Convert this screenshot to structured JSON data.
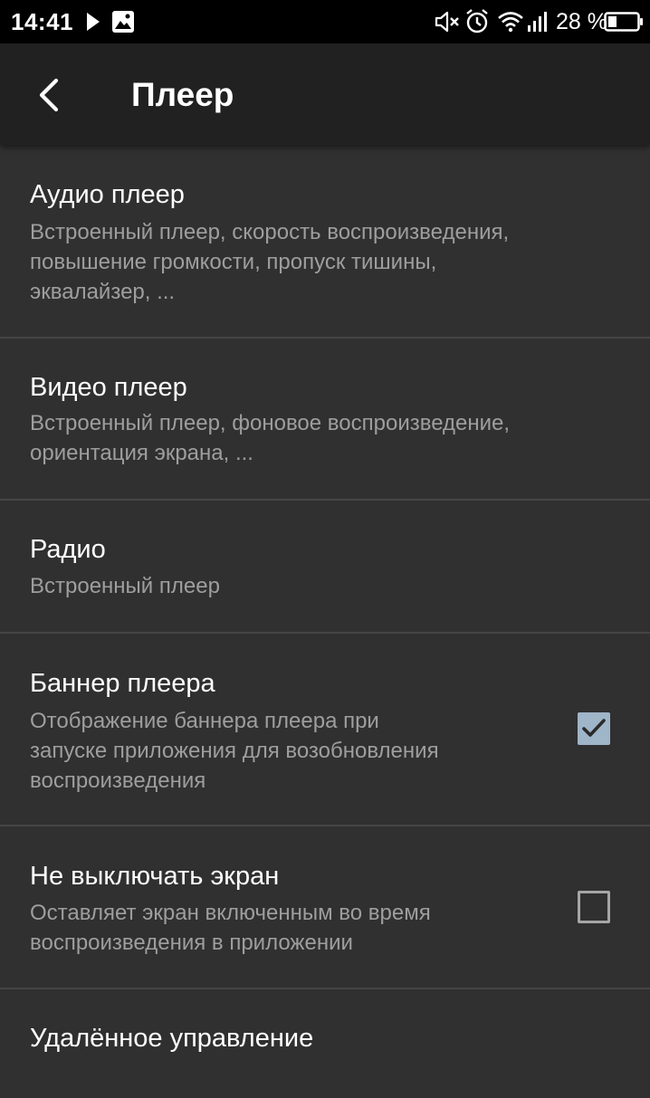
{
  "status_bar": {
    "time": "14:41",
    "battery_percent": "28 %",
    "icons": [
      "play-icon",
      "image-icon",
      "mute-icon",
      "alarm-icon",
      "wifi-icon",
      "signal-icon",
      "battery-icon"
    ]
  },
  "app_bar": {
    "back_icon": "back-arrow-icon",
    "title": "Плеер"
  },
  "settings": [
    {
      "title": "Аудио плеер",
      "summary": "Встроенный плеер, скорость воспроизведения,\nповышение громкости, пропуск тишины,\nэквалайзер, ..."
    },
    {
      "title": "Видео плеер",
      "summary": "Встроенный плеер, фоновое воспроизведение,\nориентация экрана, ..."
    },
    {
      "title": "Радио",
      "summary": "Встроенный плеер"
    },
    {
      "title": "Баннер плеера",
      "summary": "Отображение баннера плеера при\nзапуске приложения для возобновления\nвоспроизведения",
      "checked": true
    },
    {
      "title": "Не выключать экран",
      "summary": "Оставляет экран включенным во время\nвоспроизведения в приложении",
      "checked": false
    },
    {
      "title": "Удалённое управление",
      "summary": ""
    }
  ],
  "colors": {
    "background": "#303030",
    "app_bar": "#212121",
    "status_bar": "#000000",
    "summary_text": "#9e9e9e",
    "checkbox_checked": "#9fb5c8",
    "divider": "#454545"
  }
}
